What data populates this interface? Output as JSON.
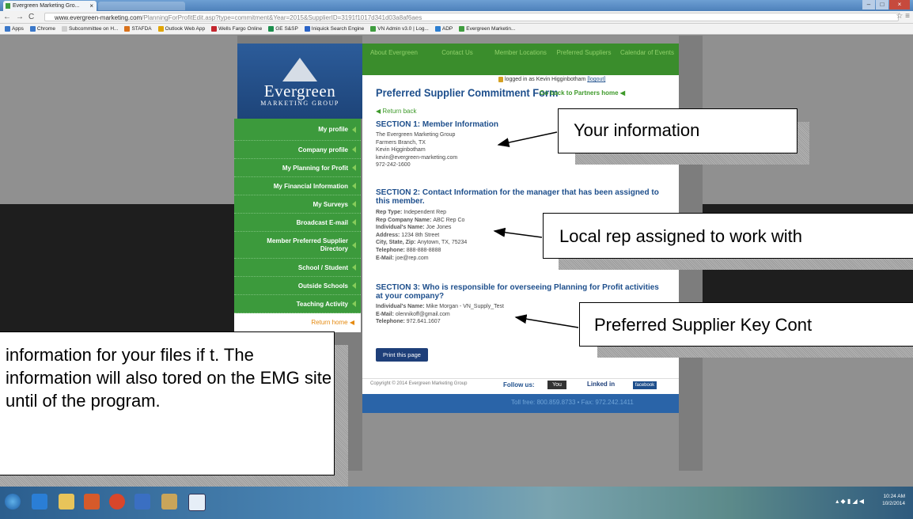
{
  "browser": {
    "tab_title": "Evergreen Marketing Gro...",
    "url_host": "www.evergreen-marketing.com",
    "url_path": "/PlanningForProfitEdit.asp?type=commitment&Year=2015&SupplierID=3191f1017d341d03a8af6aes",
    "bookmarks": [
      "Apps",
      "Chrome",
      "Subcommittee on H...",
      "STAFDA",
      "Outlook Web App",
      "Wells Fargo Online",
      "GE S&SP",
      "Iniquick Search Engine",
      "VN Admin v3.0 | Log...",
      "ADP",
      "Evergreen Marketin..."
    ],
    "bookmark_colors": [
      "#3b78c9",
      "#3b78c9",
      "#cfcfcf",
      "#d9721c",
      "#e0a400",
      "#c4262e",
      "#1c8e4d",
      "#2a63c7",
      "#3f9d3f",
      "#2d7fd1",
      "#3f9d3f"
    ]
  },
  "site": {
    "logo_name": "Evergreen",
    "logo_sub": "MARKETING GROUP",
    "top_nav": [
      "About Evergreen",
      "Contact Us",
      "Member Locations",
      "Preferred Suppliers",
      "Calendar of Events"
    ],
    "menu": [
      "My profile",
      "Company profile",
      "My Planning for Profit",
      "My Financial Information",
      "My Surveys",
      "Broadcast E-mail",
      "Member Preferred Supplier Directory",
      "School / Student",
      "Outside Schools",
      "Teaching Activity"
    ],
    "return_home": "Return home"
  },
  "form": {
    "title": "Preferred Supplier Commitment Form",
    "logged_in": "logged in as Kevin Higginbotham",
    "logout": "[logout]",
    "go_back": "Go back to Partners home",
    "return_back": "Return back",
    "section1_title": "SECTION 1: Member Information",
    "section1_lines": [
      "The Evergreen Marketing Group",
      "Farmers Branch, TX",
      "Kevin Higginbotham",
      "kevin@evergreen-marketing.com",
      "972-242-1600"
    ],
    "section2_title": "SECTION 2: Contact Information for the manager that has been assigned to this member.",
    "section2_fields": [
      {
        "label": "Rep Type:",
        "value": "Independent Rep"
      },
      {
        "label": "Rep Company Name:",
        "value": "ABC Rep Co"
      },
      {
        "label": "Individual's Name:",
        "value": "Joe Jones"
      },
      {
        "label": "Address:",
        "value": "1234 8th Street"
      },
      {
        "label": "City, State, Zip:",
        "value": "Anytown, TX, 75234"
      },
      {
        "label": "Telephone:",
        "value": "888-888-8888"
      },
      {
        "label": "E-Mail:",
        "value": "joe@rep.com"
      }
    ],
    "section3_title": "SECTION 3: Who is responsible for overseeing Planning for Profit activities at your company?",
    "section3_fields": [
      {
        "label": "Individual's Name:",
        "value": "Mike Morgan - VN_Supply_Test"
      },
      {
        "label": "E-Mail:",
        "value": "olennikoff@gmail.com"
      },
      {
        "label": "Telephone:",
        "value": "972.641.1607"
      }
    ],
    "print_button": "Print this page"
  },
  "footer": {
    "copyright": "Copyright © 2014 Evergreen Marketing Group",
    "follow_us": "Follow us:",
    "youtube": "You Tube",
    "linkedin": "Linked in",
    "facebook": "facebook",
    "toll": "Toll free: 800.859.8733 • Fax: 972.242.1411"
  },
  "callouts": {
    "your_info": "Your information",
    "local_rep": "Local rep assigned to work with",
    "key_contact": "Preferred Supplier Key Cont",
    "files_note": "information for your files if t. The information will also tored on the EMG site until of the program."
  },
  "taskbar": {
    "time": "10:24 AM",
    "date": "10/2/2014"
  }
}
